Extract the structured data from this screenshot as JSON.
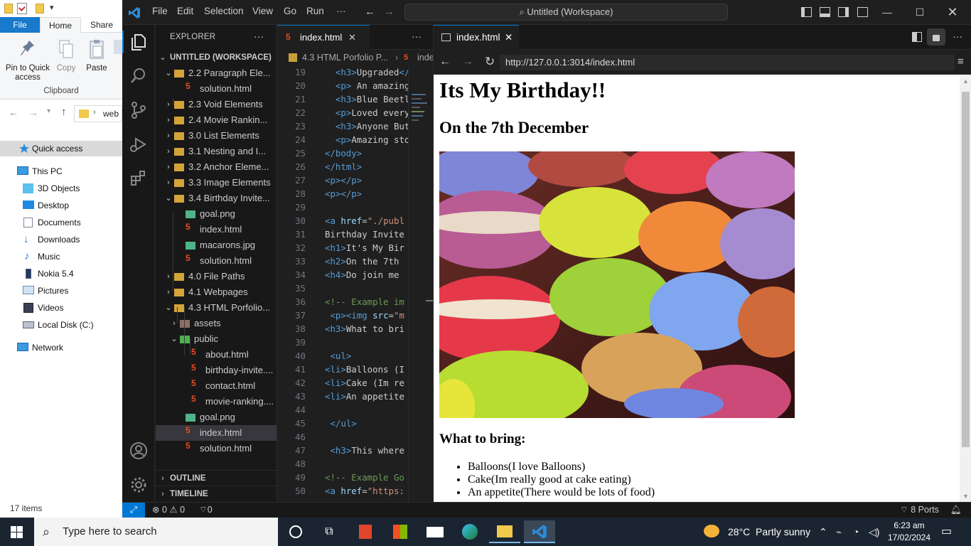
{
  "file_explorer": {
    "tabs": [
      "File",
      "Home",
      "Share"
    ],
    "ribbon": {
      "pin_label": "Pin to Quick access",
      "copy_label": "Copy",
      "paste_label": "Paste",
      "group_label": "Clipboard"
    },
    "address": "web",
    "nav": {
      "quick_access": "Quick access",
      "this_pc": "This PC",
      "items": [
        "3D Objects",
        "Desktop",
        "Documents",
        "Downloads",
        "Music",
        "Nokia 5.4",
        "Pictures",
        "Videos",
        "Local Disk (C:)"
      ],
      "network": "Network"
    },
    "status": "17 items"
  },
  "vscode": {
    "menu": [
      "File",
      "Edit",
      "Selection",
      "View",
      "Go",
      "Run",
      "···"
    ],
    "command_center": "Untitled (Workspace)",
    "explorer_title": "EXPLORER",
    "workspace": "UNTITLED (WORKSPACE)",
    "tree": [
      {
        "label": "2.2 Paragraph Ele...",
        "type": "folder",
        "open": true
      },
      {
        "label": "solution.html",
        "type": "html"
      },
      {
        "label": "2.3 Void Elements",
        "type": "folder",
        "open": false
      },
      {
        "label": "2.4 Movie Rankin...",
        "type": "folder",
        "open": false
      },
      {
        "label": "3.0 List Elements",
        "type": "folder",
        "open": false
      },
      {
        "label": "3.1 Nesting and I...",
        "type": "folder",
        "open": false
      },
      {
        "label": "3.2 Anchor Eleme...",
        "type": "folder",
        "open": false
      },
      {
        "label": "3.3 Image Elements",
        "type": "folder",
        "open": false
      },
      {
        "label": "3.4 Birthday Invite...",
        "type": "folder",
        "open": true
      },
      {
        "label": "goal.png",
        "type": "image"
      },
      {
        "label": "index.html",
        "type": "html"
      },
      {
        "label": "macarons.jpg",
        "type": "image"
      },
      {
        "label": "solution.html",
        "type": "html"
      },
      {
        "label": "4.0 File Paths",
        "type": "folder",
        "open": false
      },
      {
        "label": "4.1 Webpages",
        "type": "folder",
        "open": false
      },
      {
        "label": "4.3 HTML Porfolio...",
        "type": "folder",
        "open": true
      },
      {
        "label": "assets",
        "type": "folder",
        "open": false
      },
      {
        "label": "public",
        "type": "folder-green",
        "open": true
      },
      {
        "label": "about.html",
        "type": "html"
      },
      {
        "label": "birthday-invite....",
        "type": "html"
      },
      {
        "label": "contact.html",
        "type": "html"
      },
      {
        "label": "movie-ranking....",
        "type": "html"
      },
      {
        "label": "goal.png",
        "type": "image"
      },
      {
        "label": "index.html",
        "type": "html",
        "selected": true
      },
      {
        "label": "solution.html",
        "type": "html"
      }
    ],
    "outline": "OUTLINE",
    "timeline": "TIMELINE",
    "editor_tab": "index.html",
    "breadcrumb_folder": "4.3 HTML Porfolio P...",
    "breadcrumb_file": "inde",
    "code_lines": [
      {
        "n": "19",
        "segs": [
          [
            "  ",
            "#ccc"
          ],
          [
            "<h3>",
            "#569cd6"
          ],
          [
            "Upgraded",
            "#ccc"
          ],
          [
            "</",
            "#569cd6"
          ]
        ]
      },
      {
        "n": "20",
        "segs": [
          [
            "  ",
            "#ccc"
          ],
          [
            "<p>",
            "#569cd6"
          ],
          [
            " An amazing",
            "#ccc"
          ]
        ]
      },
      {
        "n": "21",
        "segs": [
          [
            "  ",
            "#ccc"
          ],
          [
            "<h3>",
            "#569cd6"
          ],
          [
            "Blue Beetl",
            "#ccc"
          ]
        ]
      },
      {
        "n": "22",
        "segs": [
          [
            "  ",
            "#ccc"
          ],
          [
            "<p>",
            "#569cd6"
          ],
          [
            "Loved every",
            "#ccc"
          ]
        ]
      },
      {
        "n": "23",
        "segs": [
          [
            "  ",
            "#ccc"
          ],
          [
            "<h3>",
            "#569cd6"
          ],
          [
            "Anyone But",
            "#ccc"
          ]
        ]
      },
      {
        "n": "24",
        "segs": [
          [
            "  ",
            "#ccc"
          ],
          [
            "<p>",
            "#569cd6"
          ],
          [
            "Amazing sto",
            "#ccc"
          ]
        ]
      },
      {
        "n": "25",
        "segs": [
          [
            "</body>",
            "#569cd6"
          ]
        ]
      },
      {
        "n": "26",
        "segs": [
          [
            "</html>",
            "#569cd6"
          ]
        ]
      },
      {
        "n": "27",
        "segs": [
          [
            "<p></p>",
            "#569cd6"
          ]
        ]
      },
      {
        "n": "28",
        "segs": [
          [
            "<p></p>",
            "#569cd6"
          ]
        ]
      },
      {
        "n": "29",
        "segs": []
      },
      {
        "n": "30",
        "segs": [
          [
            "<a ",
            "#569cd6"
          ],
          [
            "href",
            "#9cdcfe"
          ],
          [
            "=",
            "#ccc"
          ],
          [
            "\"./publ",
            "#ce9178"
          ]
        ]
      },
      {
        "n": "31",
        "segs": [
          [
            "Birthday Invite",
            "#ccc"
          ]
        ]
      },
      {
        "n": "32",
        "segs": [
          [
            "<h1>",
            "#569cd6"
          ],
          [
            "It's My Bir",
            "#ccc"
          ]
        ]
      },
      {
        "n": "33",
        "segs": [
          [
            "<h2>",
            "#569cd6"
          ],
          [
            "On the 7th",
            "#ccc"
          ]
        ]
      },
      {
        "n": "34",
        "segs": [
          [
            "<h4>",
            "#569cd6"
          ],
          [
            "Do join me",
            "#ccc"
          ]
        ]
      },
      {
        "n": "35",
        "segs": []
      },
      {
        "n": "36",
        "segs": [
          [
            "<!-- Example im",
            "#6a9955"
          ]
        ]
      },
      {
        "n": "37",
        "segs": [
          [
            " ",
            "#ccc"
          ],
          [
            "<p><img ",
            "#569cd6"
          ],
          [
            "src",
            "#9cdcfe"
          ],
          [
            "=",
            "#ccc"
          ],
          [
            "\"m",
            "#ce9178"
          ]
        ]
      },
      {
        "n": "38",
        "segs": [
          [
            "<h3>",
            "#569cd6"
          ],
          [
            "What to bri",
            "#ccc"
          ]
        ]
      },
      {
        "n": "39",
        "segs": []
      },
      {
        "n": "40",
        "segs": [
          [
            " ",
            "#ccc"
          ],
          [
            "<ul>",
            "#569cd6"
          ]
        ]
      },
      {
        "n": "41",
        "segs": [
          [
            "<li>",
            "#569cd6"
          ],
          [
            "Balloons (I",
            "#ccc"
          ]
        ]
      },
      {
        "n": "42",
        "segs": [
          [
            "<li>",
            "#569cd6"
          ],
          [
            "Cake (Im re",
            "#ccc"
          ]
        ]
      },
      {
        "n": "43",
        "segs": [
          [
            "<li>",
            "#569cd6"
          ],
          [
            "An appetite",
            "#ccc"
          ]
        ]
      },
      {
        "n": "44",
        "segs": []
      },
      {
        "n": "45",
        "segs": [
          [
            " ",
            "#ccc"
          ],
          [
            "</ul>",
            "#569cd6"
          ]
        ]
      },
      {
        "n": "46",
        "segs": []
      },
      {
        "n": "47",
        "segs": [
          [
            " ",
            "#ccc"
          ],
          [
            "<h3>",
            "#569cd6"
          ],
          [
            "This where",
            "#ccc"
          ]
        ]
      },
      {
        "n": "48",
        "segs": []
      },
      {
        "n": "49",
        "segs": [
          [
            "<!-- Example Go",
            "#6a9955"
          ]
        ]
      },
      {
        "n": "50",
        "segs": [
          [
            "<a ",
            "#569cd6"
          ],
          [
            "href",
            "#9cdcfe"
          ],
          [
            "=",
            "#ccc"
          ],
          [
            "\"https:",
            "#ce9178"
          ]
        ]
      }
    ],
    "preview_tab": "index.html",
    "preview_url": "http://127.0.0.1:3014/index.html",
    "page": {
      "h1": "Its My Birthday!!",
      "h2": "On the 7th December",
      "h3": "What to bring:",
      "items": [
        "Balloons(I love Balloons)",
        "Cake(Im really good at cake eating)",
        "An appetite(There would be lots of food)"
      ]
    },
    "status": {
      "problems": "0",
      "warnings": "0",
      "ports_count": "0",
      "ports": "8 Ports"
    }
  },
  "taskbar": {
    "search_placeholder": "Type here to search",
    "weather": "28°C  Partly sunny",
    "time": "6:23 am",
    "date": "17/02/2024"
  },
  "colors": {
    "vs_accent": "#0078d4",
    "explorer_file_tab": "#1979ca",
    "taskbar_bg": "#1b2531"
  }
}
